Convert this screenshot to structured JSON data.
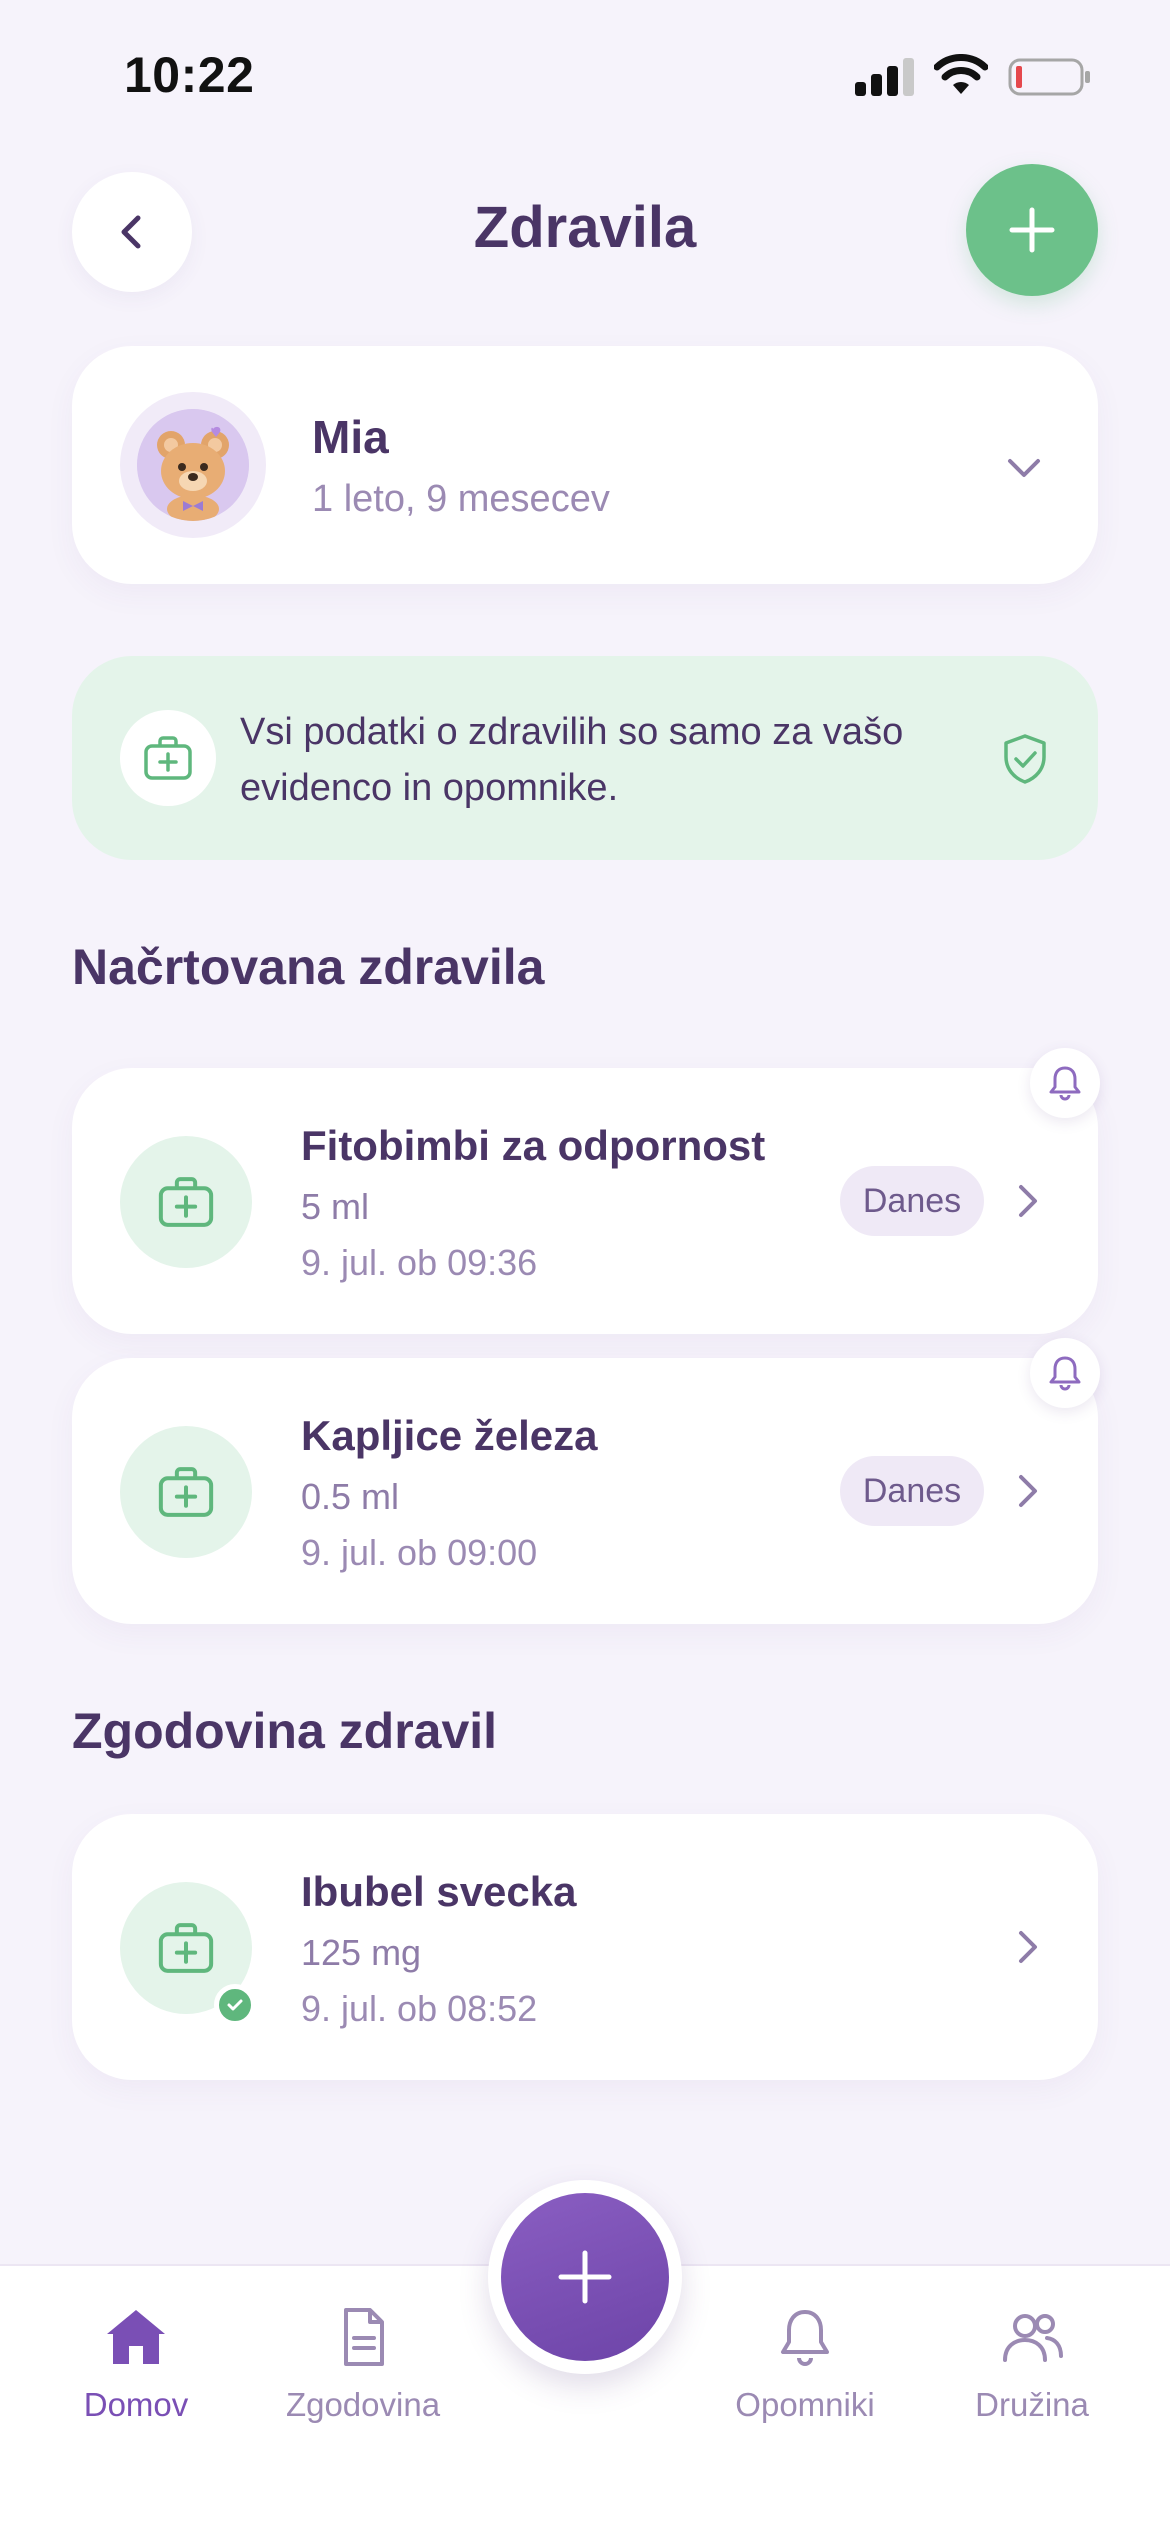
{
  "status_bar": {
    "time": "10:22"
  },
  "header": {
    "title": "Zdravila",
    "back_icon": "chevron-left-icon",
    "add_icon": "plus-icon"
  },
  "profile": {
    "name": "Mia",
    "age": "1 leto, 9 mesecev",
    "avatar": "teddy-bear-avatar"
  },
  "info_banner": {
    "text": "Vsi podatki o zdravilih so samo za vašo evidenco in opomnike.",
    "icon": "medical-kit-icon",
    "shield_icon": "shield-check-icon"
  },
  "planned": {
    "title": "Načrtovana zdravila",
    "items": [
      {
        "name": "Fitobimbi za odpornost",
        "dose": "5 ml",
        "time": "9. jul. ob 09:36",
        "badge": "Danes"
      },
      {
        "name": "Kapljice železa",
        "dose": "0.5 ml",
        "time": "9. jul. ob 09:00",
        "badge": "Danes"
      }
    ]
  },
  "history": {
    "title": "Zgodovina zdravil",
    "items": [
      {
        "name": "Ibubel svecka",
        "dose": "125 mg",
        "time": "9. jul. ob 08:52"
      }
    ]
  },
  "nav": {
    "items": [
      {
        "label": "Domov",
        "icon": "home-icon",
        "active": true
      },
      {
        "label": "Zgodovina",
        "icon": "document-icon",
        "active": false
      },
      {
        "label": "Opomniki",
        "icon": "bell-icon",
        "active": false
      },
      {
        "label": "Družina",
        "icon": "users-icon",
        "active": false
      }
    ]
  },
  "colors": {
    "accent_green": "#6cc18a",
    "accent_purple": "#7a4fb5",
    "text_dark": "#4a3566",
    "text_muted": "#9b8ab3",
    "background": "#f6f3fb"
  }
}
